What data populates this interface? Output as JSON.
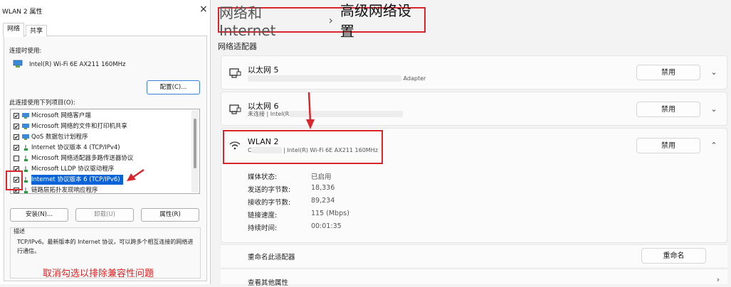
{
  "dialog": {
    "title": "WLAN 2 属性",
    "close": "×",
    "tabs": [
      "网络",
      "共享"
    ],
    "connect_using_label": "连接时使用:",
    "adapter_name": "Intel(R) Wi-Fi 6E AX211 160MHz",
    "configure_button": "配置(C)...",
    "items_label": "此连接使用下列项目(O):",
    "items": [
      {
        "label": "Microsoft 网络客户端",
        "checked": "✔"
      },
      {
        "label": "Microsoft 网络的文件和打印机共享",
        "checked": "✔"
      },
      {
        "label": "QoS 数据包计划程序",
        "checked": "✔"
      },
      {
        "label": "Internet 协议版本 4 (TCP/IPv4)",
        "checked": "✔"
      },
      {
        "label": "Microsoft 网络适配器多路传送器协议",
        "checked": ""
      },
      {
        "label": "Microsoft LLDP 协议驱动程序",
        "checked": "✔"
      },
      {
        "label": "Internet 协议版本 6 (TCP/IPv6)",
        "checked": "✔"
      },
      {
        "label": "链路层拓扑发现响应程序",
        "checked": "✔"
      }
    ],
    "install_button": "安装(N)...",
    "uninstall_button": "卸载(U)",
    "properties_button": "属性(R)",
    "description_label": "描述",
    "description_text": "TCP/IPv6。最新版本的 Internet 协议，可以跨多个相互连接的网络进行通信。",
    "annotation": "取消勾选以排除兼容性问题"
  },
  "settings": {
    "breadcrumb_parent": "网络和 Internet",
    "breadcrumb_sep": "›",
    "breadcrumb_current": "高级网络设置",
    "section_title": "网络适配器",
    "adapters": [
      {
        "name": "以太网 5",
        "sub_suffix": "Adapter",
        "button": "禁用",
        "chevron": "⌄"
      },
      {
        "name": "以太网 6",
        "sub_prefix": "未连接 | Intel(R",
        "button": "禁用",
        "chevron": "⌄"
      },
      {
        "name": "WLAN 2",
        "sub_prefix": "C",
        "sub_suffix": "| Intel(R) Wi-Fi 6E AX211 160MHz",
        "button": "禁用",
        "chevron": "⌃"
      }
    ],
    "properties": [
      {
        "label": "媒体状态:",
        "value": "已启用"
      },
      {
        "label": "发送的字节数:",
        "value": "18,336"
      },
      {
        "label": "接收的字节数:",
        "value": "89,234"
      },
      {
        "label": "链接速度:",
        "value": "115 (Mbps)"
      },
      {
        "label": "持续时间:",
        "value": "00:01:35"
      }
    ],
    "rename_label": "重命名此适配器",
    "rename_button": "重命名",
    "more_label": "查看其他属性",
    "more_chevron": "›"
  }
}
